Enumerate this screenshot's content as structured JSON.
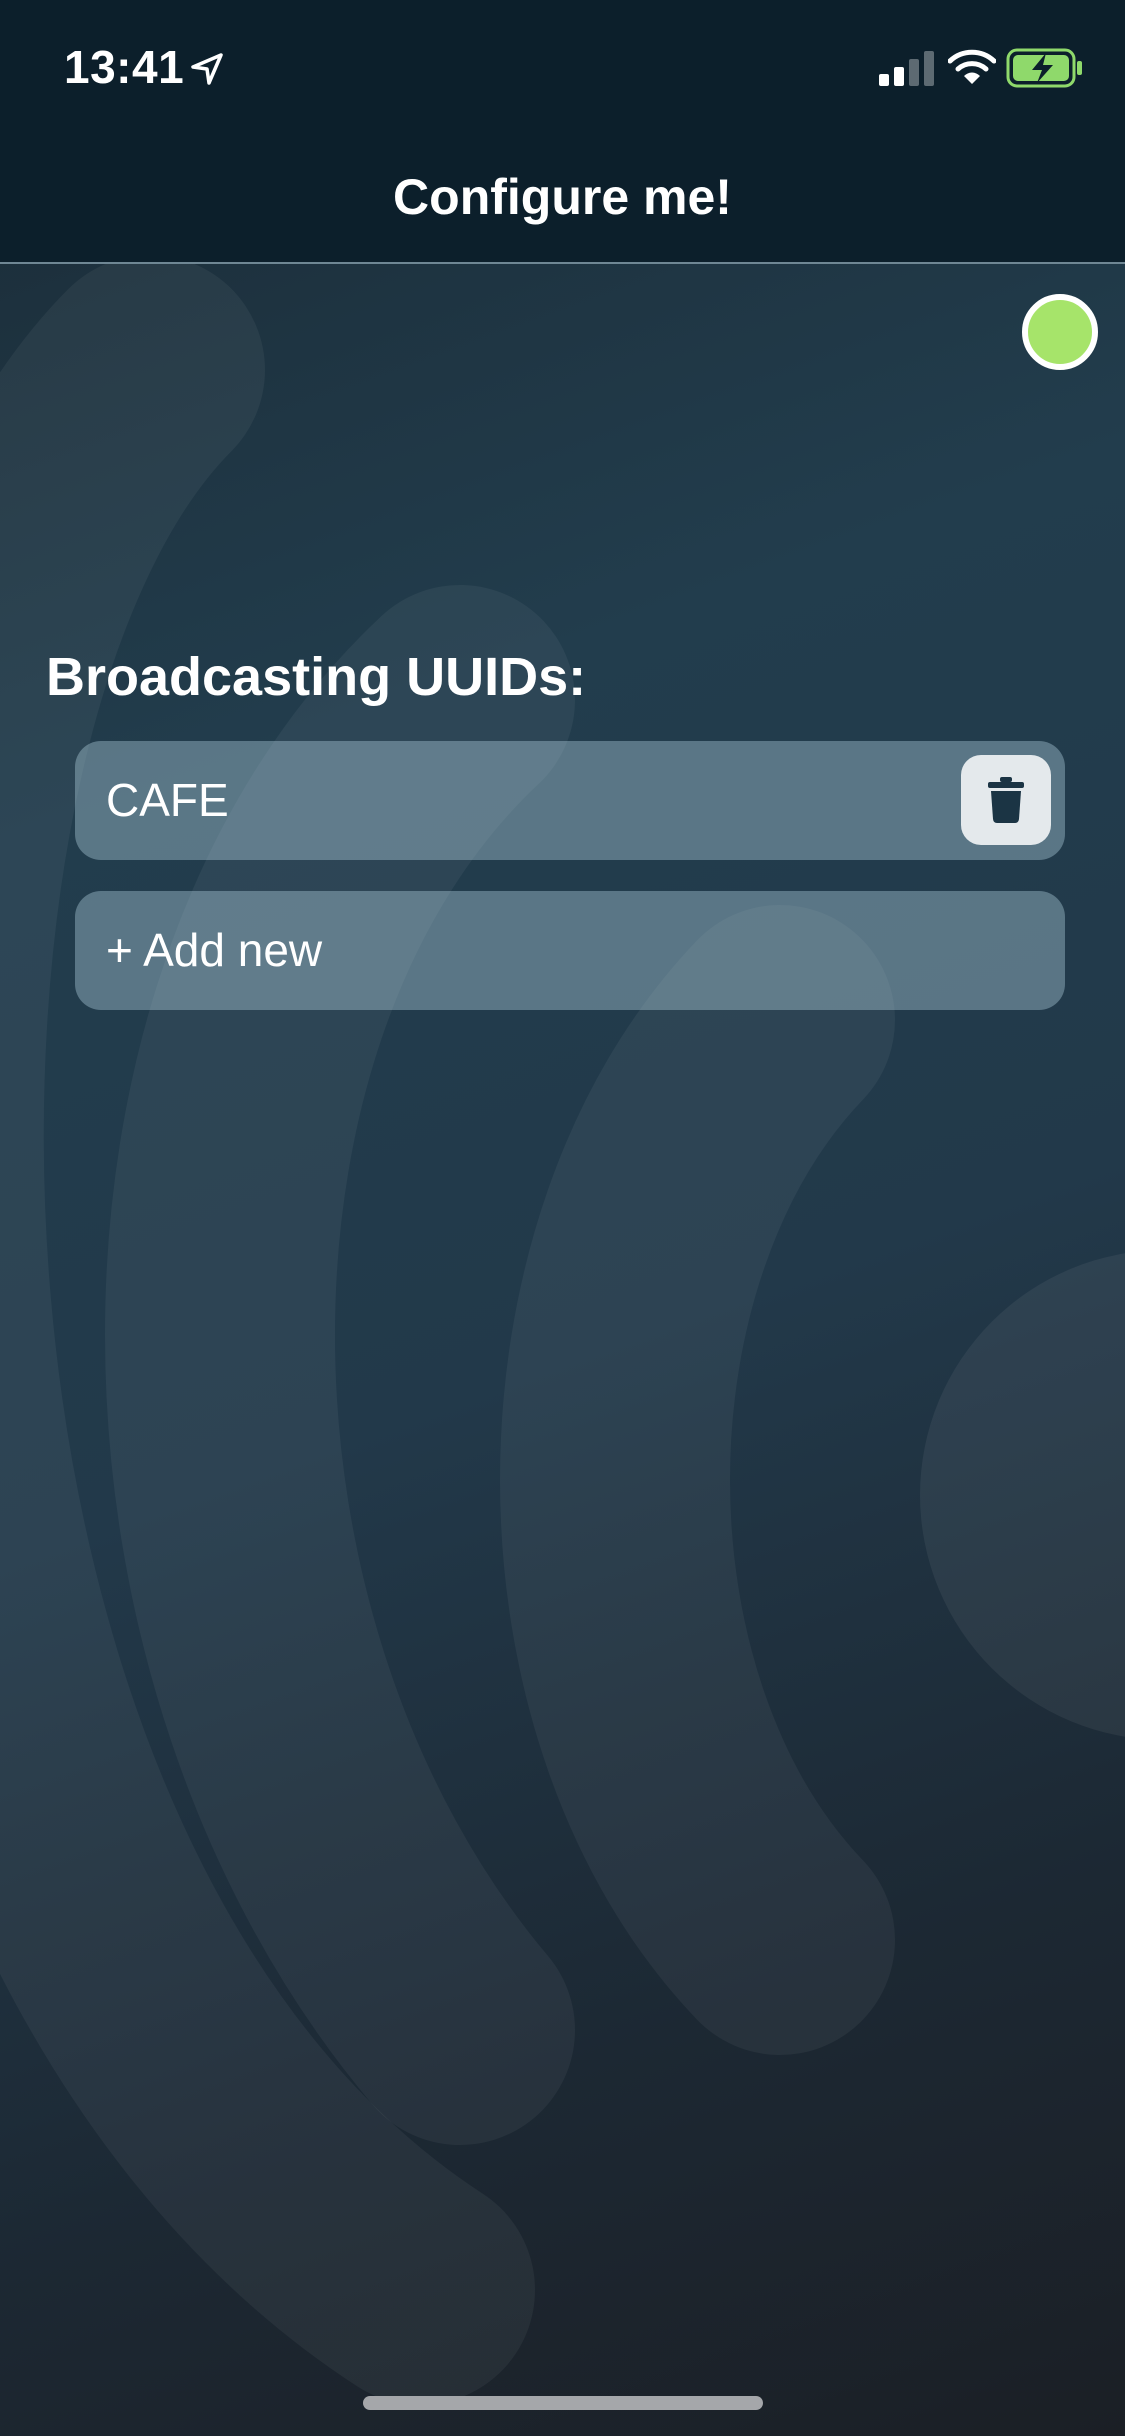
{
  "status_bar": {
    "time": "13:41",
    "location_icon": "location-arrow-icon",
    "signal_icon": "cellular-signal-icon",
    "wifi_icon": "wifi-icon",
    "battery_icon": "battery-charging-icon"
  },
  "nav": {
    "title": "Configure me!"
  },
  "status_indicator": {
    "color": "#a6e46a",
    "icon": "status-dot-icon"
  },
  "broadcast": {
    "title": "Broadcasting UUIDs:",
    "items": [
      {
        "label": "CAFE",
        "delete_icon": "trash-icon"
      }
    ],
    "add_label": "+ Add new"
  },
  "colors": {
    "nav_background": "#0c1f2b",
    "status_active": "#a6e46a",
    "row_background": "rgba(170,200,214,0.42)",
    "delete_button_background": "#e4e9ec",
    "trash_icon": "#1b3444"
  }
}
